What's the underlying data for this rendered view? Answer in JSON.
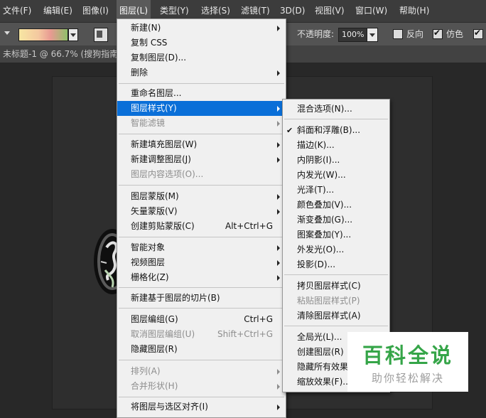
{
  "menubar": {
    "items": [
      "文件(F)",
      "编辑(E)",
      "图像(I)",
      "图层(L)",
      "类型(Y)",
      "选择(S)",
      "滤镜(T)",
      "3D(D)",
      "视图(V)",
      "窗口(W)",
      "帮助(H)"
    ]
  },
  "options": {
    "opacity_label": "不透明度:",
    "opacity_value": "100%",
    "reverse_label": "反向",
    "dither_label": "仿色"
  },
  "document": {
    "tab_title": "未标题-1 @ 66.7% (搜狗指南"
  },
  "layer_menu": {
    "items": [
      {
        "label": "新建(N)",
        "shortcut": "",
        "arrow": true,
        "disabled": false
      },
      {
        "label": "复制 CSS",
        "shortcut": "",
        "arrow": false,
        "disabled": false
      },
      {
        "label": "复制图层(D)...",
        "shortcut": "",
        "arrow": false,
        "disabled": false
      },
      {
        "label": "删除",
        "shortcut": "",
        "arrow": true,
        "disabled": false
      },
      {
        "label": "重命名图层...",
        "shortcut": "",
        "arrow": false,
        "disabled": false
      },
      {
        "label": "图层样式(Y)",
        "shortcut": "",
        "arrow": true,
        "disabled": false,
        "highlight": true
      },
      {
        "label": "智能滤镜",
        "shortcut": "",
        "arrow": true,
        "disabled": true
      },
      {
        "label": "新建填充图层(W)",
        "shortcut": "",
        "arrow": true,
        "disabled": false
      },
      {
        "label": "新建调整图层(J)",
        "shortcut": "",
        "arrow": true,
        "disabled": false
      },
      {
        "label": "图层内容选项(O)...",
        "shortcut": "",
        "arrow": false,
        "disabled": true
      },
      {
        "label": "图层蒙版(M)",
        "shortcut": "",
        "arrow": true,
        "disabled": false
      },
      {
        "label": "矢量蒙版(V)",
        "shortcut": "",
        "arrow": true,
        "disabled": false
      },
      {
        "label": "创建剪贴蒙版(C)",
        "shortcut": "Alt+Ctrl+G",
        "arrow": false,
        "disabled": false
      },
      {
        "label": "智能对象",
        "shortcut": "",
        "arrow": true,
        "disabled": false
      },
      {
        "label": "视频图层",
        "shortcut": "",
        "arrow": true,
        "disabled": false
      },
      {
        "label": "栅格化(Z)",
        "shortcut": "",
        "arrow": true,
        "disabled": false
      },
      {
        "label": "新建基于图层的切片(B)",
        "shortcut": "",
        "arrow": false,
        "disabled": false
      },
      {
        "label": "图层编组(G)",
        "shortcut": "Ctrl+G",
        "arrow": false,
        "disabled": false
      },
      {
        "label": "取消图层编组(U)",
        "shortcut": "Shift+Ctrl+G",
        "arrow": false,
        "disabled": true
      },
      {
        "label": "隐藏图层(R)",
        "shortcut": "",
        "arrow": false,
        "disabled": false
      },
      {
        "label": "排列(A)",
        "shortcut": "",
        "arrow": true,
        "disabled": true
      },
      {
        "label": "合并形状(H)",
        "shortcut": "",
        "arrow": true,
        "disabled": true
      },
      {
        "label": "将图层与选区对齐(I)",
        "shortcut": "",
        "arrow": true,
        "disabled": false
      }
    ]
  },
  "style_submenu": {
    "items": [
      {
        "label": "混合选项(N)...",
        "disabled": false,
        "checked": false
      },
      {
        "label": "斜面和浮雕(B)...",
        "disabled": false,
        "checked": true
      },
      {
        "label": "描边(K)...",
        "disabled": false,
        "checked": false
      },
      {
        "label": "内阴影(I)...",
        "disabled": false,
        "checked": false
      },
      {
        "label": "内发光(W)...",
        "disabled": false,
        "checked": false
      },
      {
        "label": "光泽(T)...",
        "disabled": false,
        "checked": false
      },
      {
        "label": "颜色叠加(V)...",
        "disabled": false,
        "checked": false
      },
      {
        "label": "渐变叠加(G)...",
        "disabled": false,
        "checked": false
      },
      {
        "label": "图案叠加(Y)...",
        "disabled": false,
        "checked": false
      },
      {
        "label": "外发光(O)...",
        "disabled": false,
        "checked": false
      },
      {
        "label": "投影(D)...",
        "disabled": false,
        "checked": false
      },
      {
        "label": "拷贝图层样式(C)",
        "disabled": false,
        "checked": false
      },
      {
        "label": "粘贴图层样式(P)",
        "disabled": true,
        "checked": false
      },
      {
        "label": "清除图层样式(A)",
        "disabled": false,
        "checked": false
      },
      {
        "label": "全局光(L)...",
        "disabled": false,
        "checked": false
      },
      {
        "label": "创建图层(R)",
        "disabled": false,
        "checked": false
      },
      {
        "label": "隐藏所有效果",
        "disabled": false,
        "checked": false
      },
      {
        "label": "缩放效果(F)...",
        "disabled": false,
        "checked": false
      }
    ]
  },
  "watermark": {
    "title": "百科全说",
    "subtitle": "助你轻松解决"
  },
  "colors": {
    "menu_highlight": "#0a6fd8",
    "watermark_green": "#35a548"
  }
}
